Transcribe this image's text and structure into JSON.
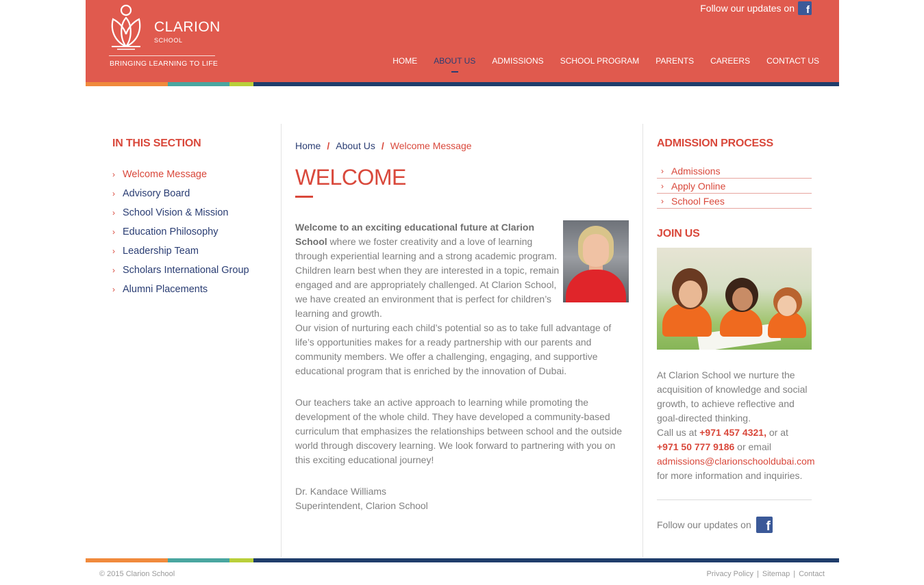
{
  "brand": {
    "name": "CLARION",
    "sub": "SCHOOL",
    "tagline": "BRINGING LEARNING TO LIFE"
  },
  "header": {
    "follow_text": "Follow our updates on",
    "nav": [
      "HOME",
      "ABOUT US",
      "ADMISSIONS",
      "SCHOOL PROGRAM",
      "PARENTS",
      "CAREERS",
      "CONTACT US"
    ],
    "active_nav": "ABOUT US"
  },
  "left": {
    "title": "IN THIS SECTION",
    "items": [
      "Welcome Message",
      "Advisory Board",
      "School Vision & Mission",
      "Education Philosophy",
      "Leadership Team",
      "Scholars International Group",
      "Alumni Placements"
    ]
  },
  "main": {
    "breadcrumb": [
      "Home",
      "About Us",
      "Welcome Message"
    ],
    "title": "WELCOME",
    "intro_bold": "Welcome to an exciting educational future at Clarion School",
    "para1_rest": " where we foster creativity and a love of learning through experiential learning and a strong academic program. Children learn best when they are interested in a topic, remain engaged and are appropriately challenged. At Clarion School, we have created an environment that is perfect for children’s learning and growth.",
    "para2": "Our vision of nurturing each child’s potential so as to take full advantage of life’s opportunities makes for a ready partnership with our parents and community members. We offer a challenging, engaging, and supportive educational program that is enriched by the innovation of Dubai.",
    "para3": "Our teachers take an active approach to learning while promoting the development of the whole child. They have developed a community-based curriculum that emphasizes the relationships between school and the outside world through discovery learning. We look forward to partnering with you on this exciting educational journey!",
    "signature_name": "Dr. Kandace Williams",
    "signature_title": "Superintendent, Clarion School"
  },
  "right": {
    "admission_title": "ADMISSION PROCESS",
    "admission_items": [
      "Admissions",
      "Apply Online",
      "School Fees"
    ],
    "join_title": "JOIN US",
    "text1": "At Clarion School we nurture the acquisition of knowledge and social growth, to achieve reflective and goal-directed thinking.",
    "call_prefix": "Call us at ",
    "phone1": "+971 457 4321,",
    "or_at": " or at",
    "phone2": "+971 50 777 9186",
    "or_email": " or email",
    "email": "admissions@clarionschooldubai.com",
    "text_end": "for more information and inquiries.",
    "follow_text": "Follow our updates on"
  },
  "footer": {
    "copyright": "© 2015 Clarion School",
    "links": [
      "Privacy Policy",
      "Sitemap",
      "Contact"
    ],
    "separator": "|"
  },
  "colors": {
    "brand_red": "#e05a4e",
    "accent_red": "#d9483b",
    "navy": "#2a3d73",
    "facebook": "#3b5998"
  },
  "icons": [
    "lotus-logo-icon",
    "facebook-icon",
    "chevron-right-icon"
  ]
}
